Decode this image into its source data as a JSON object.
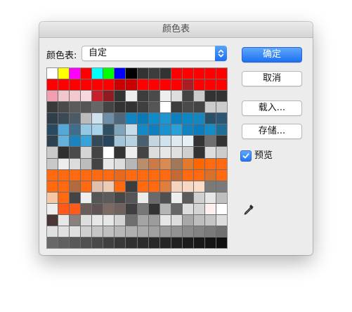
{
  "window": {
    "title": "颜色表"
  },
  "color_table": {
    "label": "颜色表:",
    "selected": "自定",
    "swatches": [
      "#ffffff",
      "#ffff00",
      "#ff00ff",
      "#ff0000",
      "#00ffff",
      "#00ff00",
      "#0000ff",
      "#000000",
      "#333333",
      "#3c3c3c",
      "#333333",
      "#ff0000",
      "#ff0000",
      "#ff0000",
      "#ff0000",
      "#ff0000",
      "#ff0000",
      "#ff0000",
      "#ff0000",
      "#ff0000",
      "#ff0000",
      "#ff0000",
      "#cc0000",
      "#cc0000",
      "#ff0000",
      "#ff0000",
      "#ff0000",
      "#ff0000",
      "#aa1d22",
      "#ff0000",
      "#ff0000",
      "#ff0000",
      "#f29db0",
      "#f1c7ce",
      "#f3c9cd",
      "#f6d9dc",
      "#c8202a",
      "#8e1c22",
      "#333333",
      "#eeeeee",
      "#3c3c3c",
      "#4a4a4a",
      "#eeeeee",
      "#dedede",
      "#444444",
      "#cccccc",
      "#333333",
      "#333333",
      "#3a3a3a",
      "#4a4a4a",
      "#5a5a5a",
      "#555555",
      "#666666",
      "#444444",
      "#333333",
      "#333333",
      "#3f3f3f",
      "#555555",
      "#ffffff",
      "#3c3c3c",
      "#4a4a4a",
      "#444444",
      "#cccccc",
      "#cccccc",
      "#2f3f4a",
      "#3a4a55",
      "#4a5a66",
      "#bbbbbb",
      "#cfe1ec",
      "#6e8fa8",
      "#4f6779",
      "#1184c3",
      "#0b79b7",
      "#0f8bc7",
      "#1e95cf",
      "#0c80be",
      "#0d86c6",
      "#1486c0",
      "#2a4f69",
      "#2c5671",
      "#2a4a60",
      "#55a9d8",
      "#3f6d8c",
      "#92c8e4",
      "#a6d3ea",
      "#2f4f63",
      "#7fa3b8",
      "#c7dde9",
      "#1389c8",
      "#0f7fbf",
      "#1b92cf",
      "#2aa0d8",
      "#1283c2",
      "#0c7cbc",
      "#148bc7",
      "#1e6e97",
      "#2c4251",
      "#63b1dc",
      "#1b83bd",
      "#37a3d9",
      "#354a59",
      "#27465c",
      "#a4c5d8",
      "#b7d2e1",
      "#4a5f70",
      "#c3d6e0",
      "#cfe2ed",
      "#dde9ef",
      "#e6f1f6",
      "#333333",
      "#6e6e6e",
      "#333333",
      "#c9c9c9",
      "#2f2f2f",
      "#4a4a4a",
      "#d5d5d5",
      "#444444",
      "#ffffff",
      "#333333",
      "#eeeeee",
      "#444444",
      "#dddddd",
      "#e6e6e6",
      "#e0e0e0",
      "#cfcfcf",
      "#333333",
      "#dddddd",
      "#cccccc",
      "#c8c8c8",
      "#eeeeee",
      "#dcdcdc",
      "#bcbcbc",
      "#444444",
      "#e8e8e8",
      "#dddddd",
      "#b7b7b7",
      "#b88f6a",
      "#cc7a45",
      "#d98a50",
      "#a1795a",
      "#e37a2b",
      "#ff6600",
      "#ff6a10",
      "#ff6a10",
      "#ff6a10",
      "#ff6a10",
      "#ff6a10",
      "#ff6a10",
      "#ff6a10",
      "#ff6a10",
      "#e9691c",
      "#ff6a10",
      "#ff6a10",
      "#ff6a10",
      "#ff6a10",
      "#c46a34",
      "#ff6a10",
      "#ff6a10",
      "#d6702b",
      "#ff6a10",
      "#ff6a10",
      "#ff6a10",
      "#b46a3f",
      "#ff6a10",
      "#e0c0ad",
      "#eccbb5",
      "#ff6a10",
      "#3c3c3c",
      "#ff6a10",
      "#ff6a10",
      "#e07e3f",
      "#f5d4bf",
      "#f8d8c4",
      "#faddc8",
      "#7a7a7a",
      "#7a7a7a",
      "#f6c7a4",
      "#ff6a10",
      "#444444",
      "#eeeeee",
      "#555555",
      "#5a5a5a",
      "#474747",
      "#555555",
      "#ececec",
      "#6a6a6a",
      "#4f4f4f",
      "#eeeeee",
      "#5a5a5a",
      "#d0d0d0",
      "#e6e6e6",
      "#bfbfbf",
      "#eeeeee",
      "#ff5a1a",
      "#ff5a1a",
      "#6a5c58",
      "#5e5352",
      "#7b6a63",
      "#6f625c",
      "#3f3f3f",
      "#777777",
      "#333333",
      "#b5b5b5",
      "#666666",
      "#dddddd",
      "#d4d4d4",
      "#ffefef",
      "#ffffff",
      "#4a3636",
      "#e6e6e6",
      "#8a7f7f",
      "#dddddd",
      "#e6e6e6",
      "#e6e6e6",
      "#d4d4d4",
      "#6e6e6e",
      "#a4a4a4",
      "#9c9c9c",
      "#e6e6e6",
      "#dddddd",
      "#a8a8a8",
      "#bdbdbd",
      "#c5c5c5",
      "#dddddd",
      "#e0e0e0",
      "#e0e0e0",
      "#e0e0e0",
      "#cfcfcf",
      "#c6c6c6",
      "#c0c0c0",
      "#b8b8b8",
      "#b0b0b0",
      "#a8a8a8",
      "#a0a0a0",
      "#9a9a9a",
      "#929292",
      "#8a8a8a",
      "#828282",
      "#7a7a7a",
      "#707070",
      "#686868",
      "#606060",
      "#585858",
      "#505050",
      "#484848",
      "#404040",
      "#383838",
      "#303030",
      "#2c2c2c",
      "#282828",
      "#242424",
      "#202020",
      "#1c1c1c",
      "#181818",
      "#141414",
      "#101010"
    ]
  },
  "buttons": {
    "ok": "确定",
    "cancel": "取消",
    "load": "载入...",
    "save": "存储..."
  },
  "preview": {
    "label": "预览",
    "checked": true
  },
  "colors": {
    "accent": "#1f71f3",
    "dialog_bg": "#ececec"
  }
}
